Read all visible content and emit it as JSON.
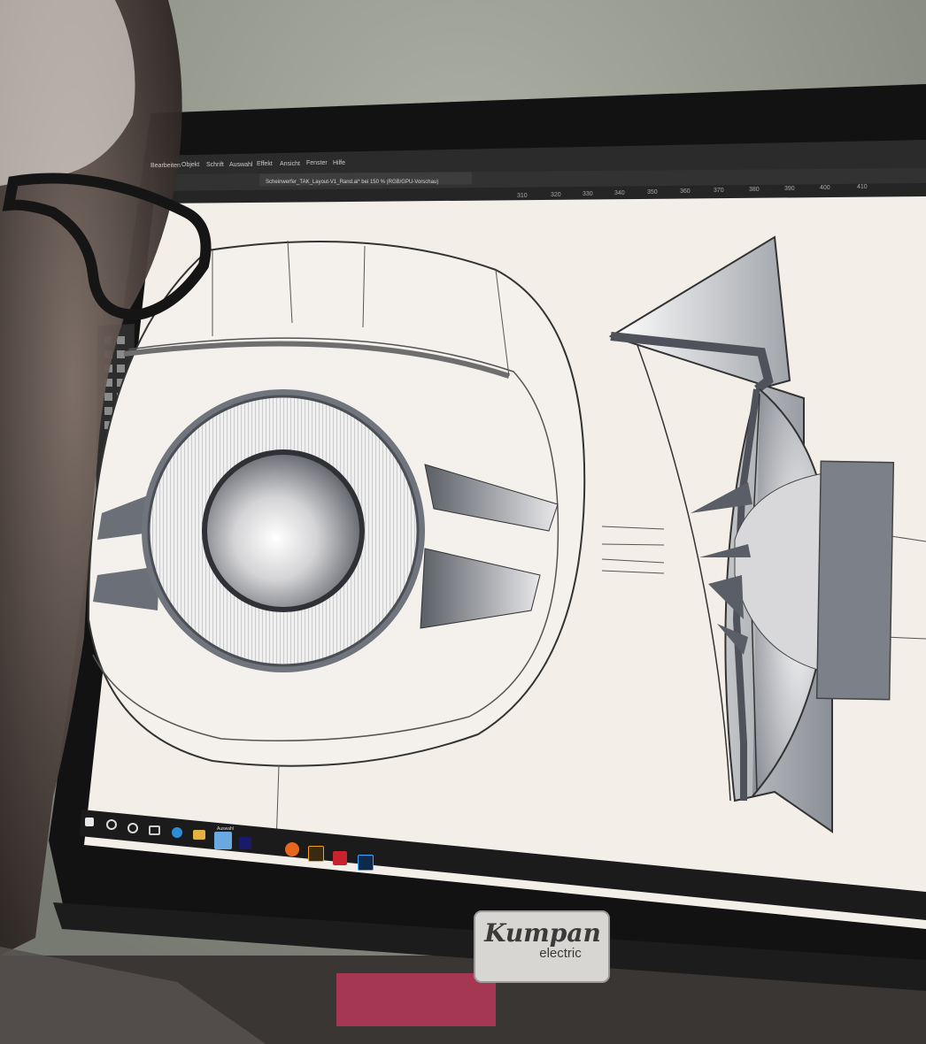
{
  "app": {
    "menu": [
      "Bearbeiten",
      "Objekt",
      "Schrift",
      "Auswahl",
      "Effekt",
      "Ansicht",
      "Fenster",
      "Hilfe"
    ],
    "document_tab": "Scheinwerfer_TAK_Layout-V1_Rand.ai* bei 150 % (RGB/GPU-Vorschau)",
    "ruler_ticks": [
      "310",
      "320",
      "330",
      "340",
      "350",
      "360",
      "370",
      "380",
      "390",
      "400",
      "410"
    ]
  },
  "taskbar": {
    "icons": [
      "windows-start-icon",
      "search-icon",
      "cortana-icon",
      "task-view-icon",
      "edge-icon",
      "file-explorer-icon",
      "store-icon",
      "premiere-icon",
      "firefox-icon",
      "illustrator-icon",
      "acrobat-icon",
      "photoshop-icon"
    ],
    "active_label": "Auswahl"
  },
  "monitor": {
    "brand": "Kumpan",
    "brand_sub": "electric"
  },
  "colors": {
    "canvas": "#f3efe8",
    "app_chrome": "#2b2b2b",
    "bezel": "#121212"
  }
}
